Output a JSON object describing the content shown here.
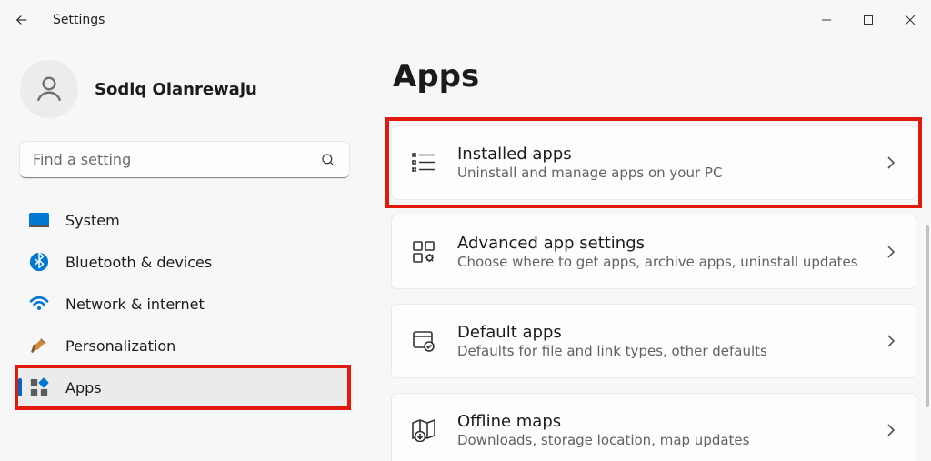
{
  "window": {
    "title": "Settings"
  },
  "user": {
    "name": "Sodiq Olanrewaju"
  },
  "search": {
    "placeholder": "Find a setting"
  },
  "nav": {
    "items": [
      {
        "label": "System"
      },
      {
        "label": "Bluetooth & devices"
      },
      {
        "label": "Network & internet"
      },
      {
        "label": "Personalization"
      },
      {
        "label": "Apps"
      }
    ],
    "active_index": 4
  },
  "page": {
    "title": "Apps"
  },
  "cards": [
    {
      "title": "Installed apps",
      "subtitle": "Uninstall and manage apps on your PC"
    },
    {
      "title": "Advanced app settings",
      "subtitle": "Choose where to get apps, archive apps, uninstall updates"
    },
    {
      "title": "Default apps",
      "subtitle": "Defaults for file and link types, other defaults"
    },
    {
      "title": "Offline maps",
      "subtitle": "Downloads, storage location, map updates"
    }
  ],
  "highlights": {
    "nav_item_index": 4,
    "card_index": 0
  }
}
